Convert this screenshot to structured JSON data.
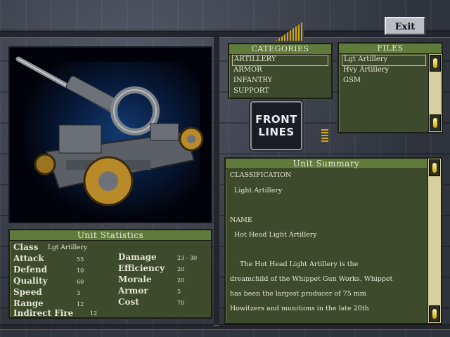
{
  "exit_label": "Exit",
  "categories": {
    "title": "CATEGORIES",
    "items": [
      "ARTILLERY",
      "ARMOR",
      "INFANTRY",
      "SUPPORT"
    ],
    "selected": "ARTILLERY"
  },
  "files": {
    "title": "FILES",
    "items": [
      "Lgt Artillery",
      "Hvy Artillery",
      "GSM"
    ],
    "selected": "Lgt Artillery"
  },
  "logo": {
    "line1": "FRONT",
    "line2": "LINES"
  },
  "summary": {
    "title": "Unit Summary",
    "lines": [
      "CLASSIFICATION",
      "Light Artillery",
      "NAME",
      "Hot Head Light Artillery",
      "The Hot Head Light Artillery is the",
      "dreamchild of the Whippet Gun Works.  Whippet",
      "has been the largest producer of 75 mm",
      "Howitzers and munitions in the late 20th"
    ]
  },
  "stats": {
    "title": "Unit Statistics",
    "class_label": "Class",
    "class_value": "Lgt Artillery",
    "left": [
      {
        "label": "Attack",
        "value": "55"
      },
      {
        "label": "Defend",
        "value": "10"
      },
      {
        "label": "Quality",
        "value": "60"
      },
      {
        "label": "Speed",
        "value": "3"
      },
      {
        "label": "Range",
        "value": "12"
      },
      {
        "label": "Indirect Fire",
        "value": "12"
      }
    ],
    "right": [
      {
        "label": "Damage",
        "value": "23 - 30"
      },
      {
        "label": "Efficiency",
        "value": "20"
      },
      {
        "label": "Morale",
        "value": "20"
      },
      {
        "label": "Armor",
        "value": "5"
      },
      {
        "label": "Cost",
        "value": "70"
      }
    ]
  },
  "colors": {
    "panel_bg": "#3e4a2c",
    "panel_title": "#5f7a3b",
    "scrollbar": "#d6cfa0",
    "accent": "#d4a800"
  }
}
